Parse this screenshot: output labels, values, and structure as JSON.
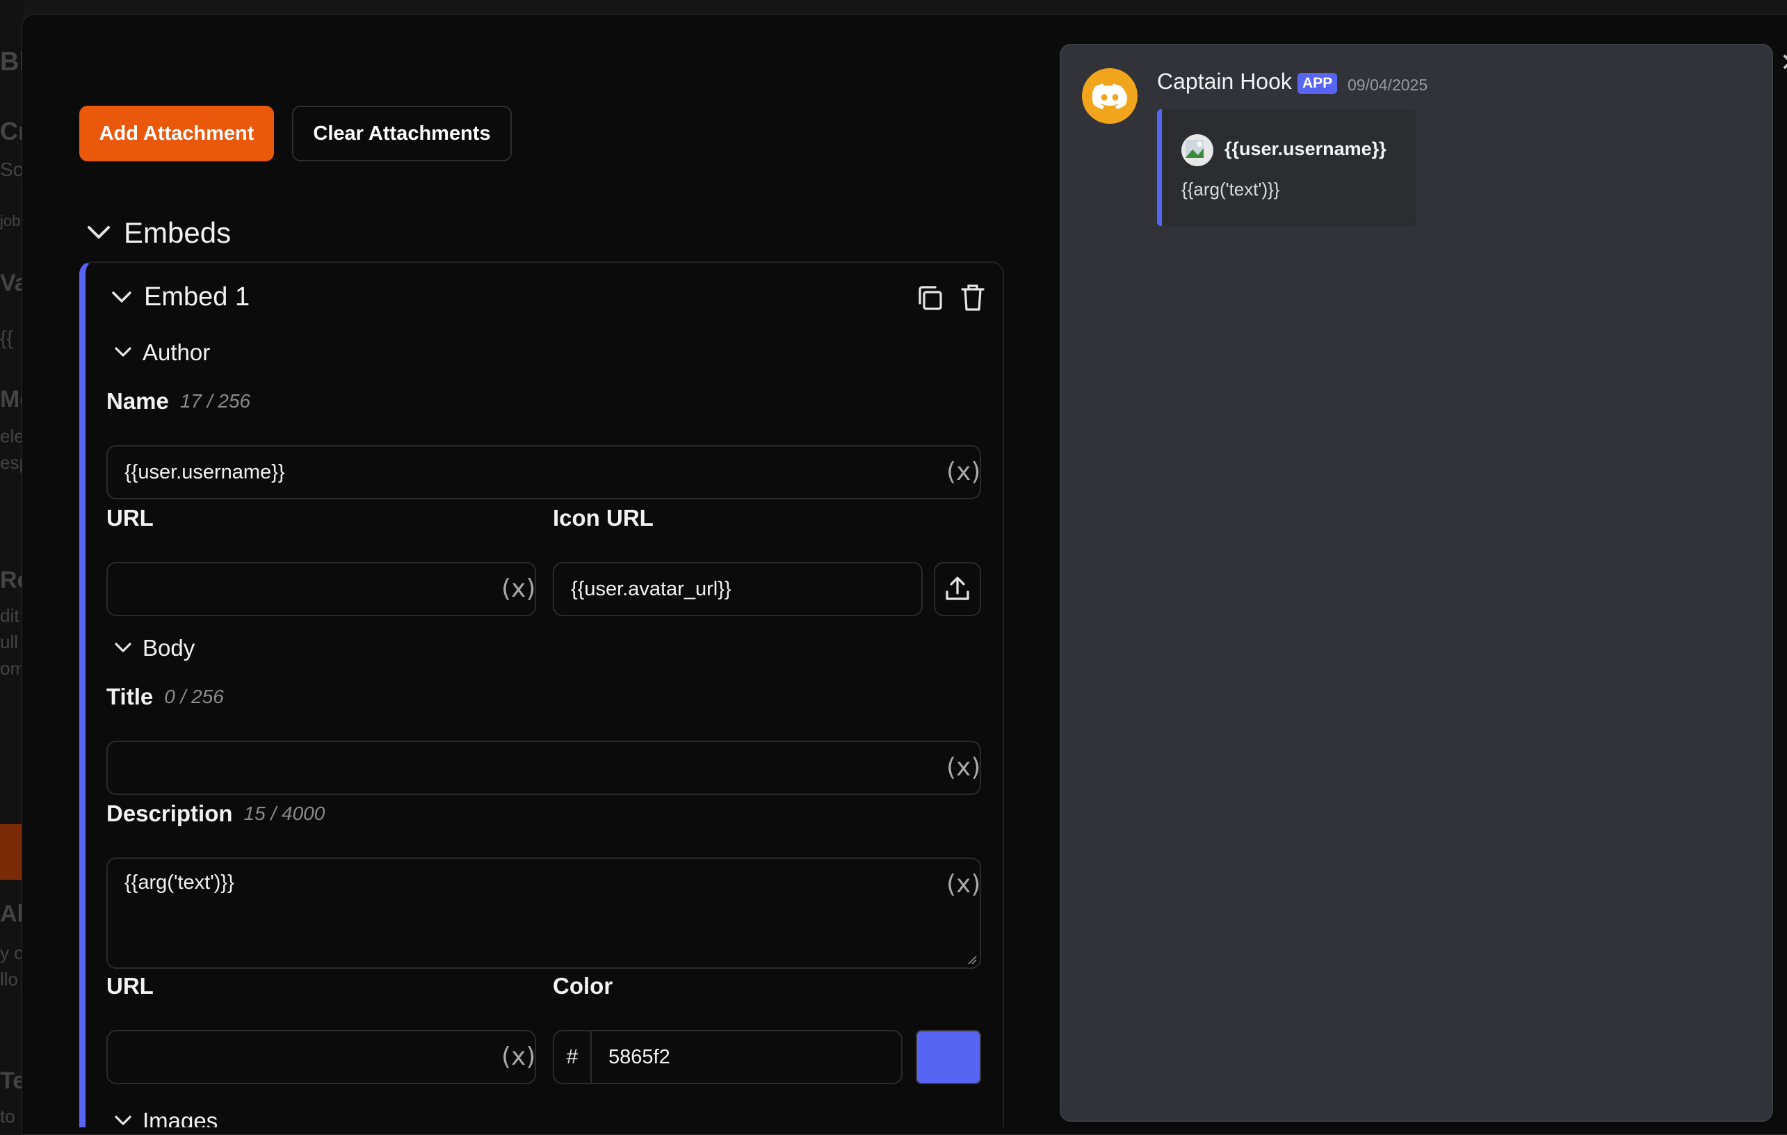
{
  "dialog": {
    "close_symbol": "✕"
  },
  "toolbar": {
    "add_attachment": "Add Attachment",
    "clear_attachments": "Clear Attachments"
  },
  "embeds": {
    "heading": "Embeds",
    "embed": {
      "title": "Embed 1",
      "author": {
        "heading": "Author",
        "name_label": "Name",
        "name_count": "17 / 256",
        "name_value": "{{user.username}}",
        "url_label": "URL",
        "url_value": "",
        "icon_url_label": "Icon URL",
        "icon_url_value": "{{user.avatar_url}}"
      },
      "body": {
        "heading": "Body",
        "title_label": "Title",
        "title_count": "0 / 256",
        "title_value": "",
        "description_label": "Description",
        "description_count": "15 / 4000",
        "description_value": "{{arg('text')}}",
        "url_label": "URL",
        "url_value": "",
        "color_label": "Color",
        "color_prefix": "#",
        "color_value": "5865f2"
      },
      "images_heading": "Images"
    }
  },
  "preview": {
    "bot_name": "Captain Hook",
    "badge": "APP",
    "date": "09/04/2025",
    "embed_author": "{{user.username}}",
    "embed_description": "{{arg('text')}}"
  },
  "colors": {
    "accent": "#ea580c",
    "embed_color": "#5865f2",
    "avatar_bg": "#f0a51c"
  }
}
